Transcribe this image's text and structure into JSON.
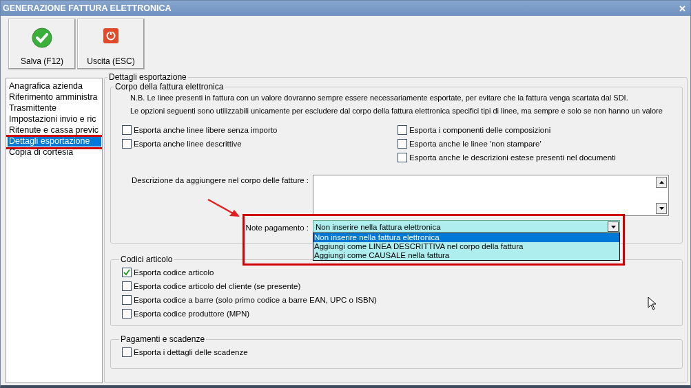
{
  "window": {
    "title": "GENERAZIONE FATTURA ELETTRONICA"
  },
  "toolbar": {
    "buttons": [
      {
        "label": "Salva (F12)",
        "kind": "save"
      },
      {
        "label": "Uscita (ESC)",
        "kind": "exit"
      }
    ]
  },
  "sidebar": {
    "items": [
      {
        "label": "Anagrafica azienda",
        "selected": false,
        "highlighted": false
      },
      {
        "label": "Riferimento amministra",
        "selected": false,
        "highlighted": false
      },
      {
        "label": "Trasmittente",
        "selected": false,
        "highlighted": false
      },
      {
        "label": "Impostazioni invio e ric",
        "selected": false,
        "highlighted": false
      },
      {
        "label": "Ritenute e cassa previc",
        "selected": false,
        "highlighted": false
      },
      {
        "label": "Dettagli esportazione",
        "selected": true,
        "highlighted": true
      },
      {
        "label": "Copia di cortesia",
        "selected": false,
        "highlighted": false
      }
    ]
  },
  "details": {
    "title": "Dettagli esportazione",
    "body_group": {
      "title": "Corpo della fattura elettronica",
      "notes": [
        "N.B. Le linee presenti in fattura con un valore dovranno sempre essere necessariamente esportate, per evitare che la fattura venga scartata dal SDI.",
        "Le opzioni seguenti sono utilizzabili unicamente per escludere dal corpo della fattura elettronica specifici tipi di linee, ma sempre e solo se non hanno un valore"
      ],
      "options_left": [
        {
          "label": "Esporta anche linee libere senza importo",
          "checked": false
        },
        {
          "label": "Esporta anche linee descrittive",
          "checked": false
        }
      ],
      "options_right": [
        {
          "label": "Esporta i componenti delle composizioni",
          "checked": false
        },
        {
          "label": "Esporta anche le linee 'non stampare'",
          "checked": false
        },
        {
          "label": "Esporta anche le descrizioni estese presenti nel documenti",
          "checked": false
        }
      ],
      "description": {
        "label": "Descrizione da aggiungere nel corpo delle fatture :"
      },
      "payment_notes": {
        "label": "Note pagamento :",
        "value": "Non inserire nella fattura elettronica",
        "expanded": true,
        "highlighted": true,
        "options": [
          {
            "label": "Non inserire nella fattura elettronica",
            "selected": true
          },
          {
            "label": "Aggiungi come LINEA DESCRITTIVA nel corpo della fattura",
            "selected": false
          },
          {
            "label": "Aggiungi come CAUSALE nella fattura",
            "selected": false
          }
        ]
      }
    },
    "article_codes": {
      "title": "Codici articolo",
      "options": [
        {
          "label": "Esporta codice articolo",
          "checked": true
        },
        {
          "label": "Esporta codice articolo del cliente (se presente)",
          "checked": false
        },
        {
          "label": "Esporta codice a barre (solo primo codice a barre EAN, UPC o ISBN)",
          "checked": false
        },
        {
          "label": "Esporta codice produttore (MPN)",
          "checked": false
        }
      ]
    },
    "payments": {
      "title": "Pagamenti e scadenze",
      "options": [
        {
          "label": "Esporta i dettagli delle scadenze",
          "checked": false
        }
      ]
    }
  }
}
